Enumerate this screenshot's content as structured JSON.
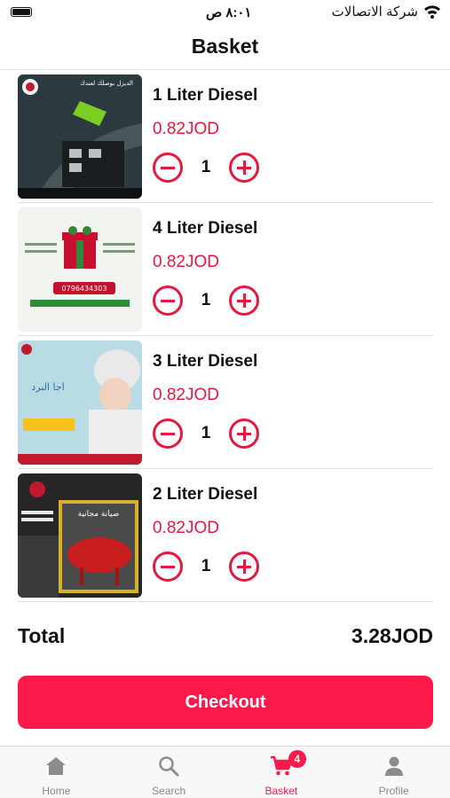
{
  "status_bar": {
    "time": "٨:٠١ ص",
    "carrier": "شركة الاتصالات"
  },
  "header": {
    "title": "Basket"
  },
  "items": [
    {
      "name": "1 Liter Diesel",
      "price": "0.82JOD",
      "quantity": "1",
      "image_text": "الديزل بوصلك لعندك"
    },
    {
      "name": "4 Liter Diesel",
      "price": "0.82JOD",
      "quantity": "1",
      "image_text": "0796434303"
    },
    {
      "name": "3 Liter Diesel",
      "price": "0.82JOD",
      "quantity": "1",
      "image_text": "اجا البرد"
    },
    {
      "name": "2 Liter Diesel",
      "price": "0.82JOD",
      "quantity": "1",
      "image_text": "صيانة مجانية"
    }
  ],
  "summary": {
    "total_label": "Total",
    "total_value": "3.28JOD"
  },
  "checkout": {
    "label": "Checkout"
  },
  "tabbar": {
    "tabs": [
      {
        "label": "Home",
        "icon": "home-icon"
      },
      {
        "label": "Search",
        "icon": "search-icon"
      },
      {
        "label": "Basket",
        "icon": "cart-icon",
        "badge": "4",
        "active": true
      },
      {
        "label": "Profile",
        "icon": "profile-icon"
      }
    ]
  },
  "colors": {
    "accent": "#fb1a4a",
    "price": "#e8173e",
    "tab_inactive": "#888888"
  }
}
